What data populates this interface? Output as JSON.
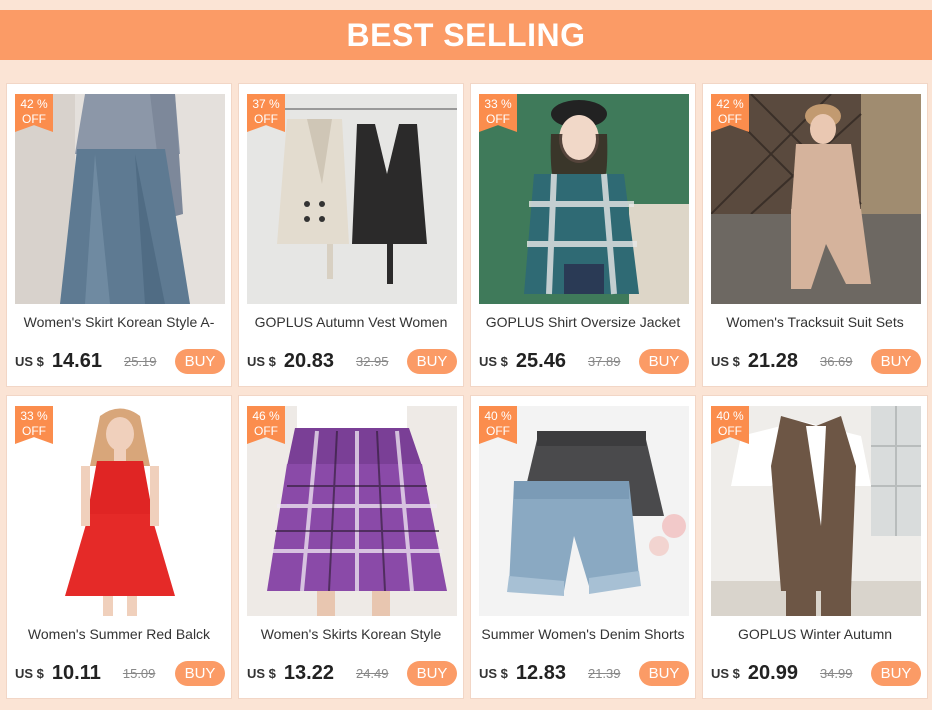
{
  "banner": {
    "title": "BEST SELLING"
  },
  "colors": {
    "accent": "#fb9b66",
    "badge": "#fb8d4d",
    "background": "#fbe4d5"
  },
  "products": [
    {
      "discount": "42 %",
      "off": "OFF",
      "title": "Women's Skirt Korean Style A-",
      "currency": "US $",
      "price": "14.61",
      "old_price": "25.19",
      "buy": "BUY"
    },
    {
      "discount": "37 %",
      "off": "OFF",
      "title": "GOPLUS Autumn Vest Women",
      "currency": "US $",
      "price": "20.83",
      "old_price": "32.95",
      "buy": "BUY"
    },
    {
      "discount": "33 %",
      "off": "OFF",
      "title": "GOPLUS Shirt Oversize Jacket",
      "currency": "US $",
      "price": "25.46",
      "old_price": "37.89",
      "buy": "BUY"
    },
    {
      "discount": "42 %",
      "off": "OFF",
      "title": "Women's Tracksuit Suit Sets",
      "currency": "US $",
      "price": "21.28",
      "old_price": "36.69",
      "buy": "BUY"
    },
    {
      "discount": "33 %",
      "off": "OFF",
      "title": "Women's Summer Red Balck",
      "currency": "US $",
      "price": "10.11",
      "old_price": "15.09",
      "buy": "BUY"
    },
    {
      "discount": "46 %",
      "off": "OFF",
      "title": "Women's Skirts Korean Style",
      "currency": "US $",
      "price": "13.22",
      "old_price": "24.49",
      "buy": "BUY"
    },
    {
      "discount": "40 %",
      "off": "OFF",
      "title": "Summer Women's Denim Shorts",
      "currency": "US $",
      "price": "12.83",
      "old_price": "21.39",
      "buy": "BUY"
    },
    {
      "discount": "40 %",
      "off": "OFF",
      "title": "GOPLUS Winter Autumn",
      "currency": "US $",
      "price": "20.99",
      "old_price": "34.99",
      "buy": "BUY"
    }
  ]
}
